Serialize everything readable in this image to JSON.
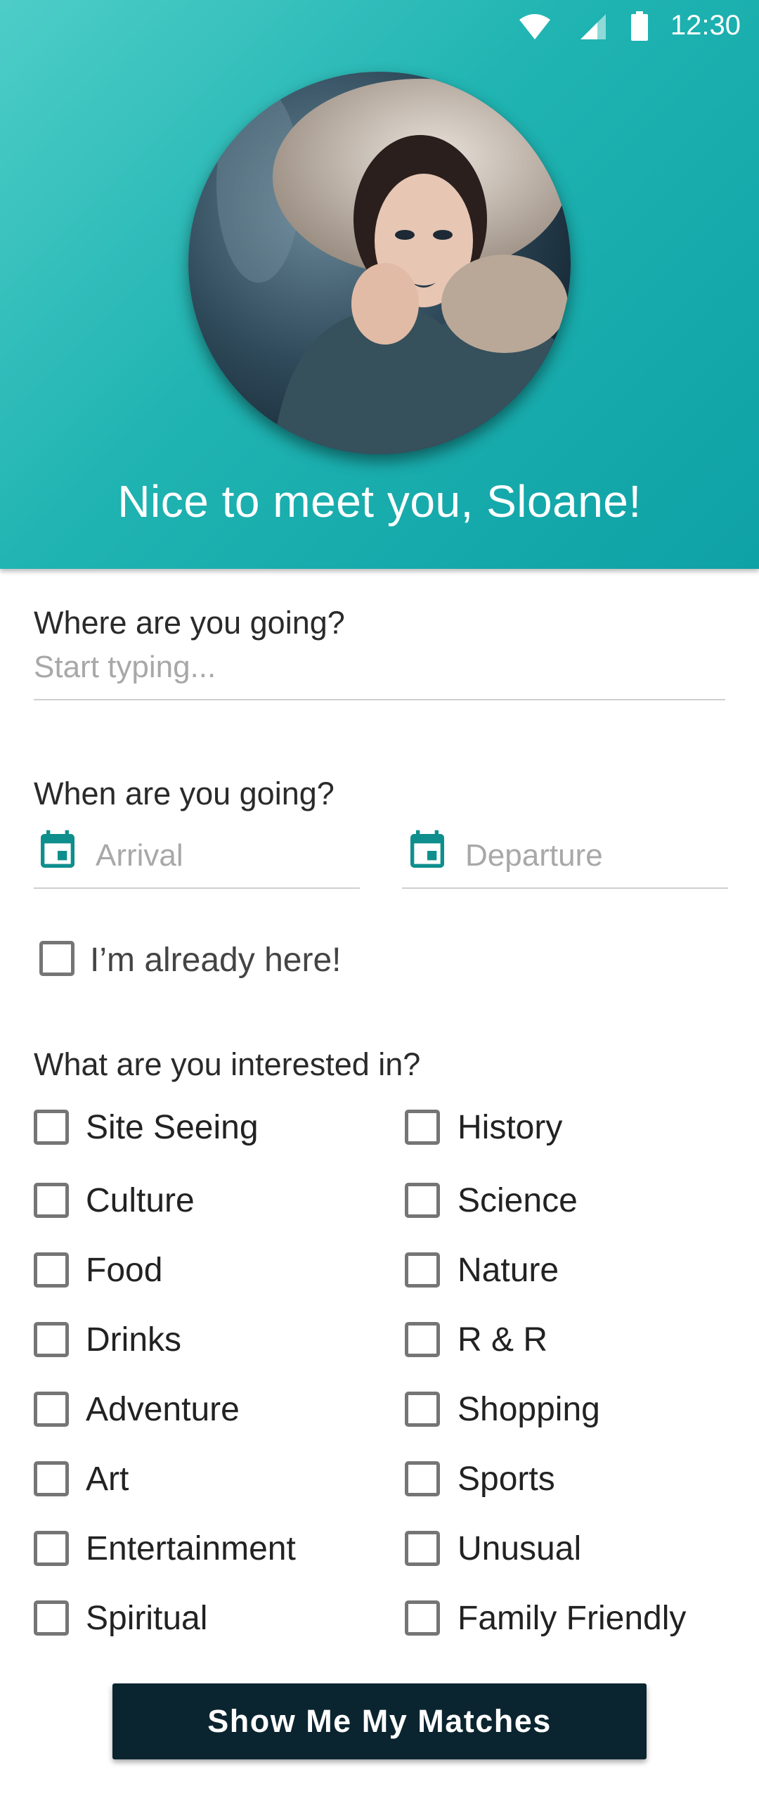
{
  "status_bar": {
    "time": "12:30"
  },
  "header": {
    "greeting": "Nice to meet you, Sloane!"
  },
  "destination": {
    "label": "Where are you going?",
    "placeholder": "Start typing..."
  },
  "dates": {
    "label": "When are you going?",
    "arrival": "Arrival",
    "departure": "Departure"
  },
  "already_here": {
    "label": "I’m already here!"
  },
  "interests": {
    "label": "What are you interested in?",
    "left": [
      "Site Seeing",
      "Culture",
      "Food",
      "Drinks",
      "Adventure",
      "Art",
      "Entertainment",
      "Spiritual"
    ],
    "right": [
      "History",
      "Science",
      "Nature",
      "R & R",
      "Shopping",
      "Sports",
      "Unusual",
      "Family Friendly"
    ]
  },
  "cta": {
    "label": "Show Me My Matches"
  },
  "colors": {
    "accent": "#0e8f8d",
    "header_top": "#4ecdc8",
    "header_bottom": "#0ea1a6",
    "button": "#0b2530"
  }
}
